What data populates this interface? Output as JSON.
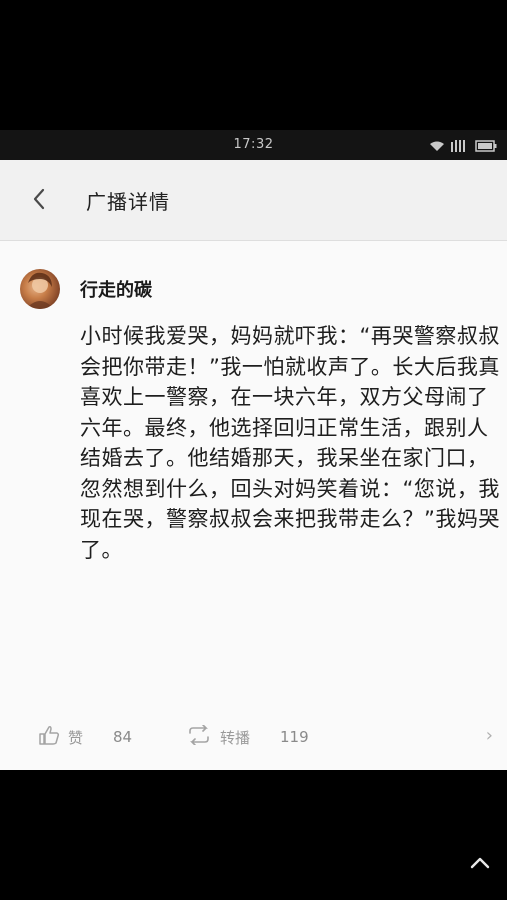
{
  "status_bar": {
    "time": "17:32"
  },
  "header": {
    "title": "广播详情"
  },
  "post": {
    "author": "行走的碳",
    "body": "小时候我爱哭，妈妈就吓我：“再哭警察叔叔会把你带走！”我一怕就收声了。长大后我真喜欢上一警察，在一块六年，双方父母闹了六年。最终，他选择回归正常生活，跟别人结婚去了。他结婚那天，我呆坐在家门口，忽然想到什么，回头对妈笑着说：“您说，我现在哭，警察叔叔会来把我带走么？”我妈哭了。"
  },
  "actions": {
    "like": {
      "label": "赞",
      "count": "84",
      "icon": "thumbs-up-icon"
    },
    "repost": {
      "label": "转播",
      "count": "119",
      "icon": "repost-icon"
    }
  },
  "colors": {
    "background": "#000000",
    "status_bar": "#141414",
    "header": "#f1f1f1",
    "content_bg": "#fafafa",
    "text": "#1e1e1e",
    "muted": "#9a9a9a"
  }
}
